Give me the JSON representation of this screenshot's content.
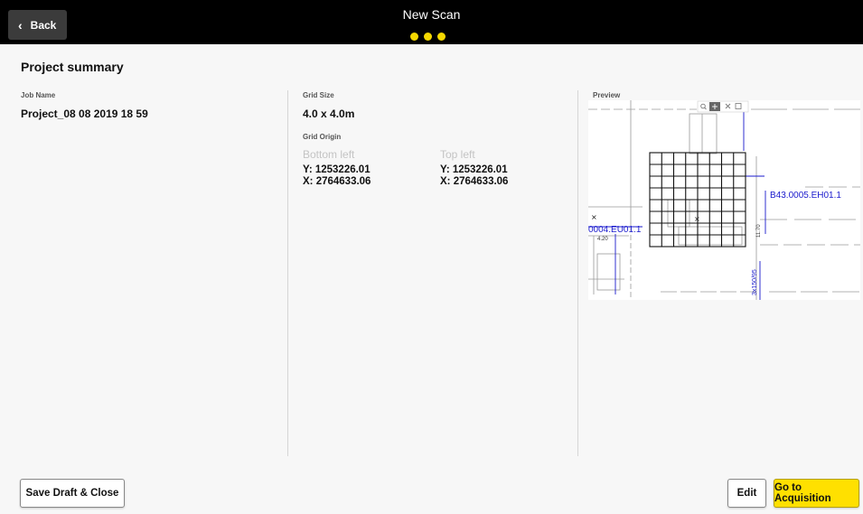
{
  "header": {
    "back_label": "Back",
    "title": "New Scan",
    "step_count": 3,
    "step_color": "#f5d800"
  },
  "summary": {
    "title": "Project summary",
    "job_name_caption": "Job Name",
    "job_name": "Project_08 08 2019 18 59",
    "grid_size_caption": "Grid Size",
    "grid_size": "4.0 x 4.0m",
    "grid_origin_caption": "Grid Origin",
    "origins": [
      {
        "label": "Bottom left",
        "y": "Y: 1253226.01",
        "x": "X: 2764633.06"
      },
      {
        "label": "Top left",
        "y": "Y: 1253226.01",
        "x": "X: 2764633.06"
      }
    ],
    "preview_caption": "Preview"
  },
  "preview_map": {
    "labels": {
      "right_annotation": "B43.0005.EH01.1",
      "left_annotation": "0004.EU01.1",
      "small_dim": "4.20",
      "vertical_dim": "11.70",
      "vertical_cable": "3x150/95"
    },
    "tools": [
      "search-icon",
      "pan-icon",
      "close-icon",
      "expand-icon"
    ],
    "accent_color": "#1a1acd"
  },
  "footer": {
    "save_label": "Save Draft & Close",
    "edit_label": "Edit",
    "go_label": "Go to Acquisition",
    "primary_color": "#ffe000"
  }
}
